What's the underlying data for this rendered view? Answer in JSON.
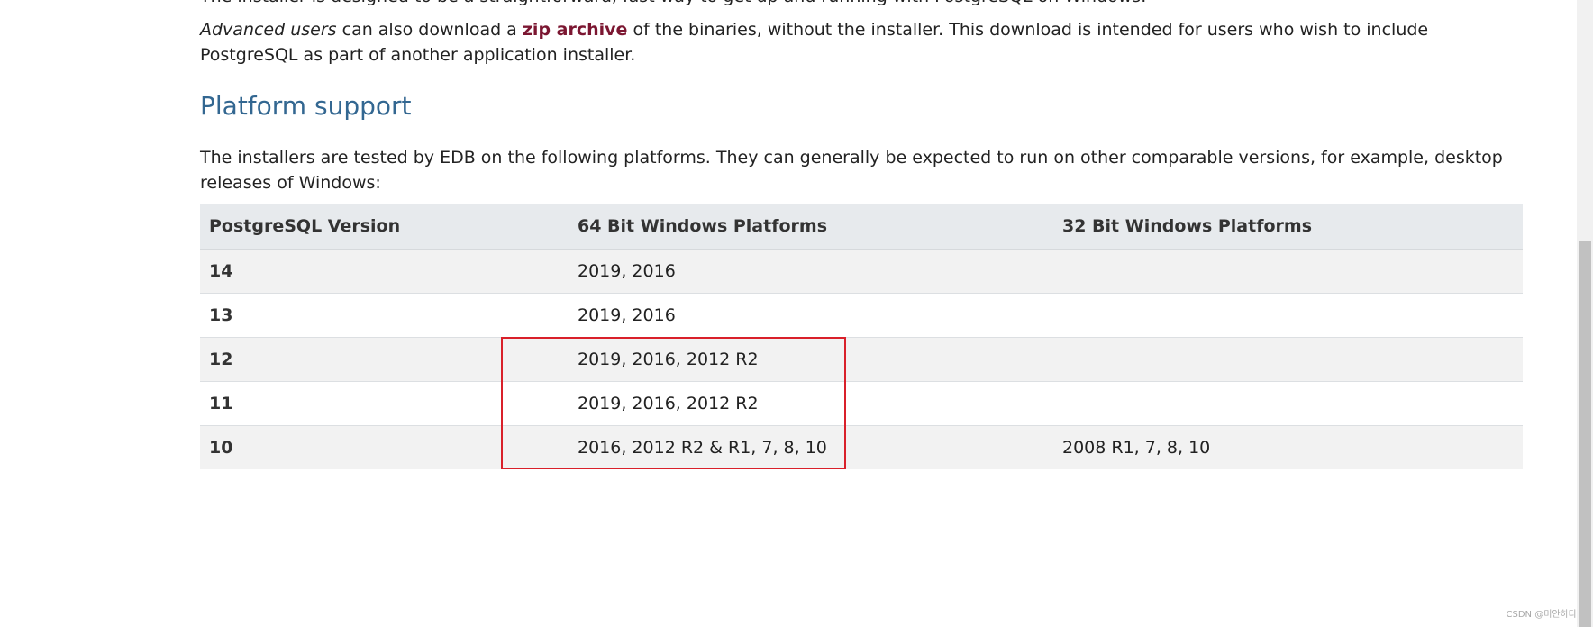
{
  "intro": {
    "cut_text": "The installer is designed to be a straightforward, fast way to get up and running with PostgreSQL on Windows."
  },
  "advanced": {
    "em_text": "Advanced users",
    "text_before_link": " can also download a ",
    "link_text": "zip archive",
    "text_after_link": " of the binaries, without the installer. This download is intended for users who wish to include PostgreSQL as part of another application installer."
  },
  "platform_support": {
    "heading": "Platform support",
    "description": "The installers are tested by EDB on the following platforms. They can generally be expected to run on other comparable versions, for example, desktop releases of Windows:"
  },
  "table": {
    "headers": [
      "PostgreSQL Version",
      "64 Bit Windows Platforms",
      "32 Bit Windows Platforms"
    ],
    "rows": [
      {
        "version": "14",
        "win64": "2019, 2016",
        "win32": ""
      },
      {
        "version": "13",
        "win64": "2019, 2016",
        "win32": ""
      },
      {
        "version": "12",
        "win64": "2019, 2016, 2012 R2",
        "win32": ""
      },
      {
        "version": "11",
        "win64": "2019, 2016, 2012 R2",
        "win32": ""
      },
      {
        "version": "10",
        "win64": "2016, 2012 R2 & R1, 7, 8, 10",
        "win32": "2008 R1, 7, 8, 10"
      }
    ]
  },
  "watermark": "CSDN @미안하다",
  "colors": {
    "link": "#7b1631",
    "heading": "#336791",
    "highlight_border": "#d9202a"
  }
}
